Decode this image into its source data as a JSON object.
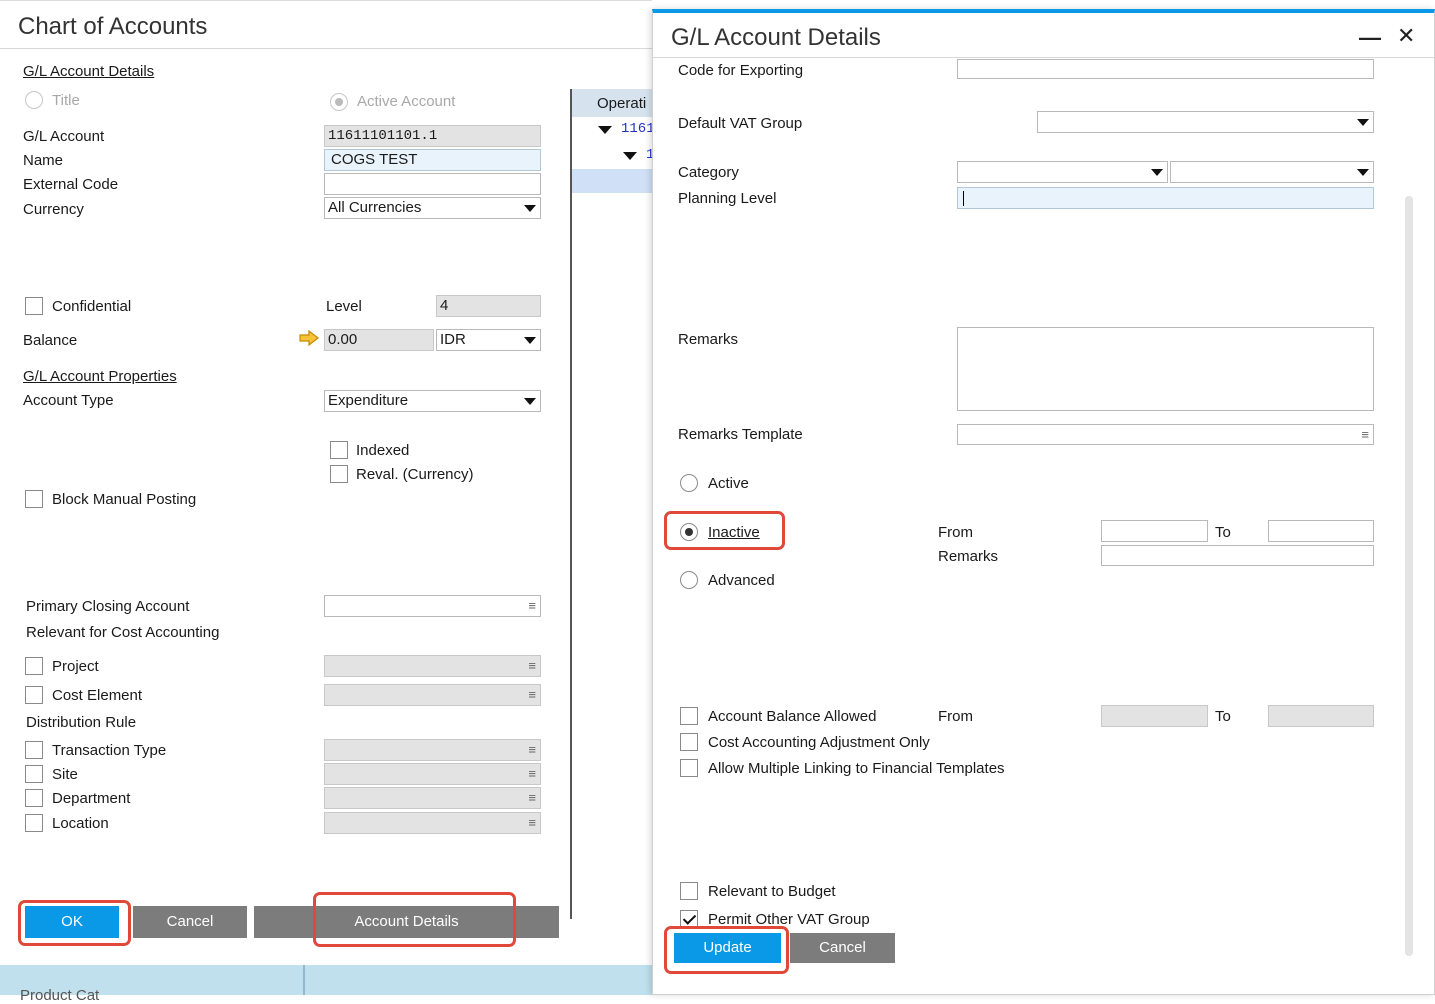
{
  "coa": {
    "title": "Chart of Accounts",
    "details_link": "G/L Account Details",
    "radio_title": "Title",
    "radio_active": "Active Account",
    "gl_account_label": "G/L Account",
    "gl_account_value": "11611101101.1",
    "name_label": "Name",
    "name_value": "COGS TEST",
    "external_code_label": "External Code",
    "currency_label": "Currency",
    "currency_value": "All Currencies",
    "confidential_label": "Confidential",
    "level_label": "Level",
    "level_value": "4",
    "balance_label": "Balance",
    "balance_value": "0.00",
    "balance_currency": "IDR",
    "properties_link": "G/L Account Properties",
    "account_type_label": "Account Type",
    "account_type_value": "Expenditure",
    "indexed_label": "Indexed",
    "reval_label": "Reval. (Currency)",
    "block_manual_label": "Block Manual Posting",
    "primary_closing_label": "Primary Closing Account",
    "relevant_cost_label": "Relevant for Cost Accounting",
    "project_label": "Project",
    "cost_element_label": "Cost Element",
    "distribution_rule_label": "Distribution Rule",
    "transaction_type_label": "Transaction Type",
    "site_label": "Site",
    "department_label": "Department",
    "location_label": "Location",
    "ok_label": "OK",
    "cancel_label": "Cancel",
    "account_details_label": "Account Details"
  },
  "tree": {
    "header": "Operati",
    "row1": "1161",
    "row2": "1"
  },
  "details": {
    "title": "G/L Account Details",
    "minimize": "—",
    "close": "✕",
    "code_export_label": "Code for Exporting",
    "default_vat_label": "Default VAT Group",
    "category_label": "Category",
    "planning_level_label": "Planning Level",
    "remarks_label": "Remarks",
    "remarks_template_label": "Remarks Template",
    "active_label": "Active",
    "inactive_label": "Inactive",
    "advanced_label": "Advanced",
    "from_label": "From",
    "to_label": "To",
    "inactive_remarks_label": "Remarks",
    "acct_balance_allowed_label": "Account Balance Allowed",
    "balance_from_label": "From",
    "balance_to_label": "To",
    "cost_adj_label": "Cost Accounting Adjustment Only",
    "multi_link_label": "Allow Multiple Linking to Financial Templates",
    "relevant_budget_label": "Relevant to Budget",
    "permit_vat_label": "Permit Other VAT Group",
    "update_label": "Update",
    "cancel_label": "Cancel"
  },
  "bottom": {
    "partial_text": "Product Cat"
  },
  "colors": {
    "accent": "#0a99e6",
    "highlight": "#e0493a"
  }
}
